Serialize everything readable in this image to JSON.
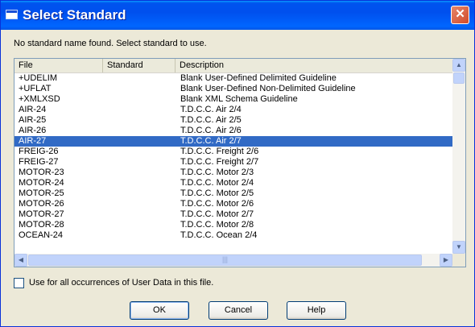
{
  "window": {
    "title": "Select Standard",
    "close_label": "✕"
  },
  "message": "No standard name found. Select standard to use.",
  "list": {
    "columns": [
      "File",
      "Standard",
      "Description"
    ],
    "rows": [
      {
        "file": "+UDELIM",
        "standard": "",
        "description": "Blank User-Defined Delimited Guideline"
      },
      {
        "file": "+UFLAT",
        "standard": "",
        "description": "Blank User-Defined Non-Delimited Guideline"
      },
      {
        "file": "+XMLXSD",
        "standard": "",
        "description": "Blank XML Schema Guideline"
      },
      {
        "file": "AIR-24",
        "standard": "",
        "description": "T.D.C.C. Air 2/4"
      },
      {
        "file": "AIR-25",
        "standard": "",
        "description": "T.D.C.C. Air 2/5"
      },
      {
        "file": "AIR-26",
        "standard": "",
        "description": "T.D.C.C. Air 2/6"
      },
      {
        "file": "AIR-27",
        "standard": "",
        "description": "T.D.C.C. Air 2/7",
        "selected": true
      },
      {
        "file": "FREIG-26",
        "standard": "",
        "description": "T.D.C.C. Freight 2/6"
      },
      {
        "file": "FREIG-27",
        "standard": "",
        "description": "T.D.C.C. Freight 2/7"
      },
      {
        "file": "MOTOR-23",
        "standard": "",
        "description": "T.D.C.C. Motor 2/3"
      },
      {
        "file": "MOTOR-24",
        "standard": "",
        "description": "T.D.C.C. Motor 2/4"
      },
      {
        "file": "MOTOR-25",
        "standard": "",
        "description": "T.D.C.C. Motor 2/5"
      },
      {
        "file": "MOTOR-26",
        "standard": "",
        "description": "T.D.C.C. Motor 2/6"
      },
      {
        "file": "MOTOR-27",
        "standard": "",
        "description": "T.D.C.C. Motor 2/7"
      },
      {
        "file": "MOTOR-28",
        "standard": "",
        "description": "T.D.C.C. Motor 2/8"
      },
      {
        "file": "OCEAN-24",
        "standard": "",
        "description": "T.D.C.C. Ocean 2/4"
      }
    ]
  },
  "scroll": {
    "up": "▲",
    "down": "▼",
    "left": "◀",
    "right": "▶",
    "grip": "|||"
  },
  "checkbox": {
    "label": "Use for all occurrences of User Data in this file.",
    "checked": false
  },
  "buttons": {
    "ok": "OK",
    "cancel": "Cancel",
    "help": "Help"
  }
}
